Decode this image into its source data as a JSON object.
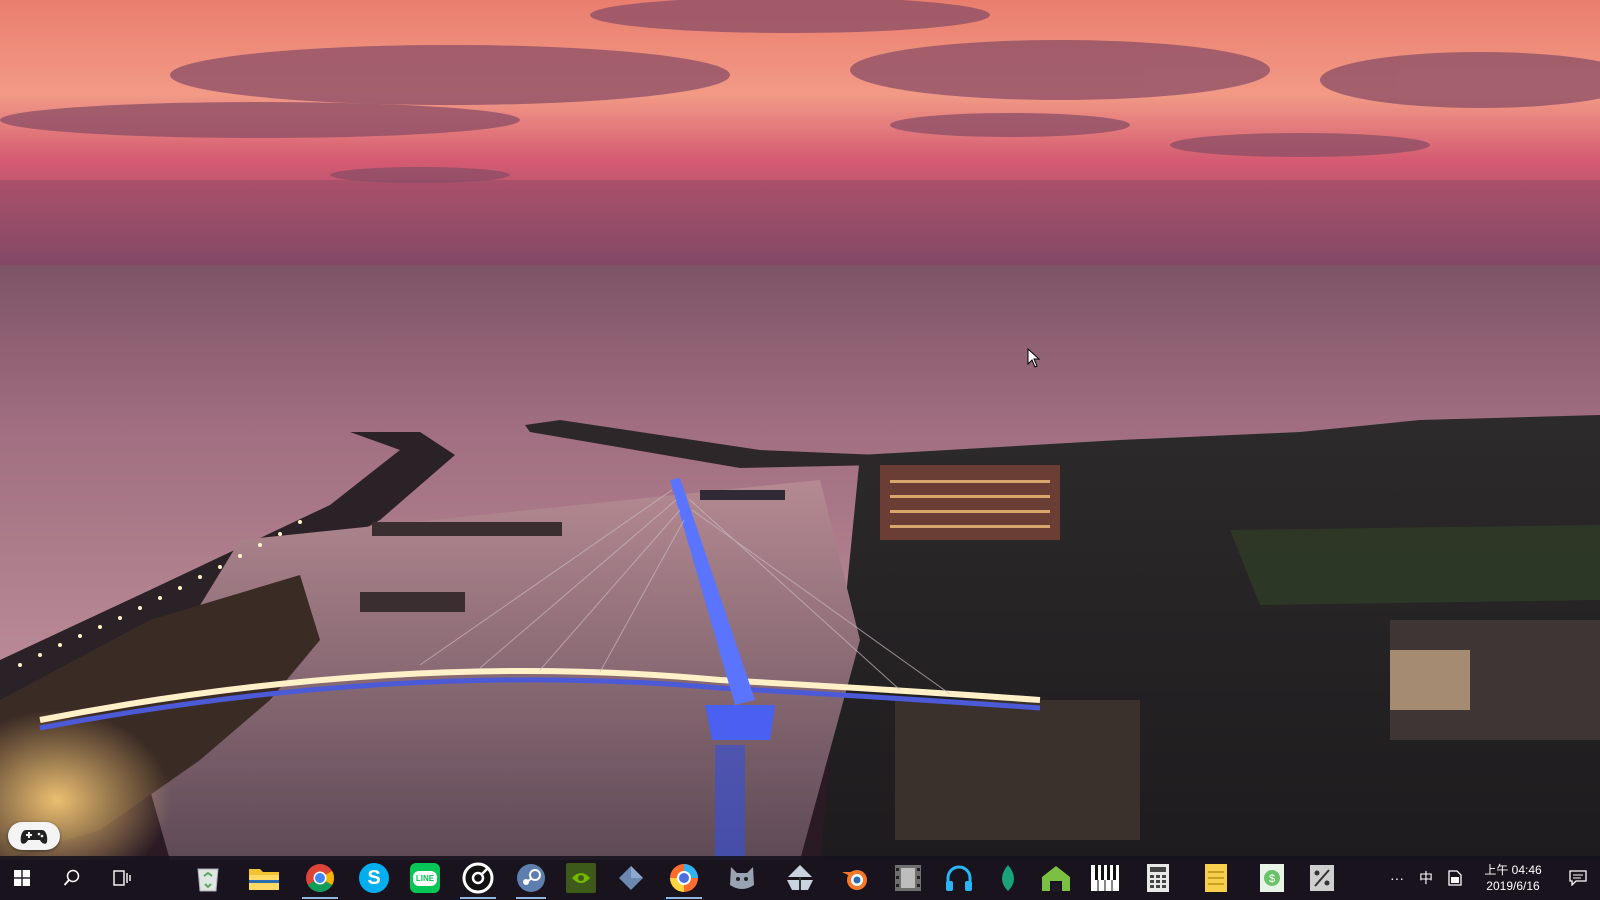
{
  "desktop": {
    "wallpaper": "harbor-bridge-sunset"
  },
  "gamebar": {
    "icon": "gamepad-icon"
  },
  "taskbar": {
    "start_icon": "windows-logo-icon",
    "search_icon": "search-icon",
    "taskview_icon": "task-view-icon",
    "apps": [
      {
        "name": "recycle-bin",
        "icon": "recycle-bin-icon",
        "color": "#9ec39b"
      },
      {
        "name": "file-explorer",
        "icon": "folder-icon",
        "color": "#f2c230"
      },
      {
        "name": "chrome",
        "icon": "chrome-icon",
        "color": "#4285f4"
      },
      {
        "name": "skype",
        "icon": "skype-icon",
        "color": "#00aff0"
      },
      {
        "name": "line",
        "icon": "line-icon",
        "color": "#06c755",
        "label": "LINE"
      },
      {
        "name": "music-player",
        "icon": "disc-icon",
        "color": "#ffffff"
      },
      {
        "name": "steam",
        "icon": "steam-icon",
        "color": "#5c7fb0"
      },
      {
        "name": "nvidia",
        "icon": "nvidia-icon",
        "color": "#76b900"
      },
      {
        "name": "cube-app",
        "icon": "cube-icon",
        "color": "#6a88b0"
      },
      {
        "name": "photo-app",
        "icon": "swirl-icon",
        "color": "#ff6d2e"
      },
      {
        "name": "cat-app",
        "icon": "cat-icon",
        "color": "#9aa3b2"
      },
      {
        "name": "boat-app",
        "icon": "boat-icon",
        "color": "#c9d3e0"
      },
      {
        "name": "blender",
        "icon": "blender-icon",
        "color": "#f5792a"
      },
      {
        "name": "film-app",
        "icon": "film-icon",
        "color": "#9a9a9a"
      },
      {
        "name": "headphones-app",
        "icon": "headphones-icon",
        "color": "#29b6f6"
      },
      {
        "name": "leaf-app",
        "icon": "leaf-icon",
        "color": "#1aa37a"
      },
      {
        "name": "house-app",
        "icon": "house-icon",
        "color": "#7cc043"
      },
      {
        "name": "piano-app",
        "icon": "piano-icon",
        "color": "#ffffff"
      },
      {
        "name": "calculator",
        "icon": "calculator-icon",
        "color": "#e8e8e8"
      },
      {
        "name": "notes-app",
        "icon": "notes-icon",
        "color": "#f7cf4a"
      },
      {
        "name": "money-app",
        "icon": "money-icon",
        "color": "#6ac36a"
      },
      {
        "name": "percent-app",
        "icon": "percent-icon",
        "color": "#cfcfcf"
      }
    ],
    "tray": {
      "overflow_label": "···",
      "ime_label": "中",
      "note_icon": "note-icon",
      "time": "上午 04:46",
      "date": "2019/6/16",
      "notification_icon": "notification-icon"
    }
  }
}
